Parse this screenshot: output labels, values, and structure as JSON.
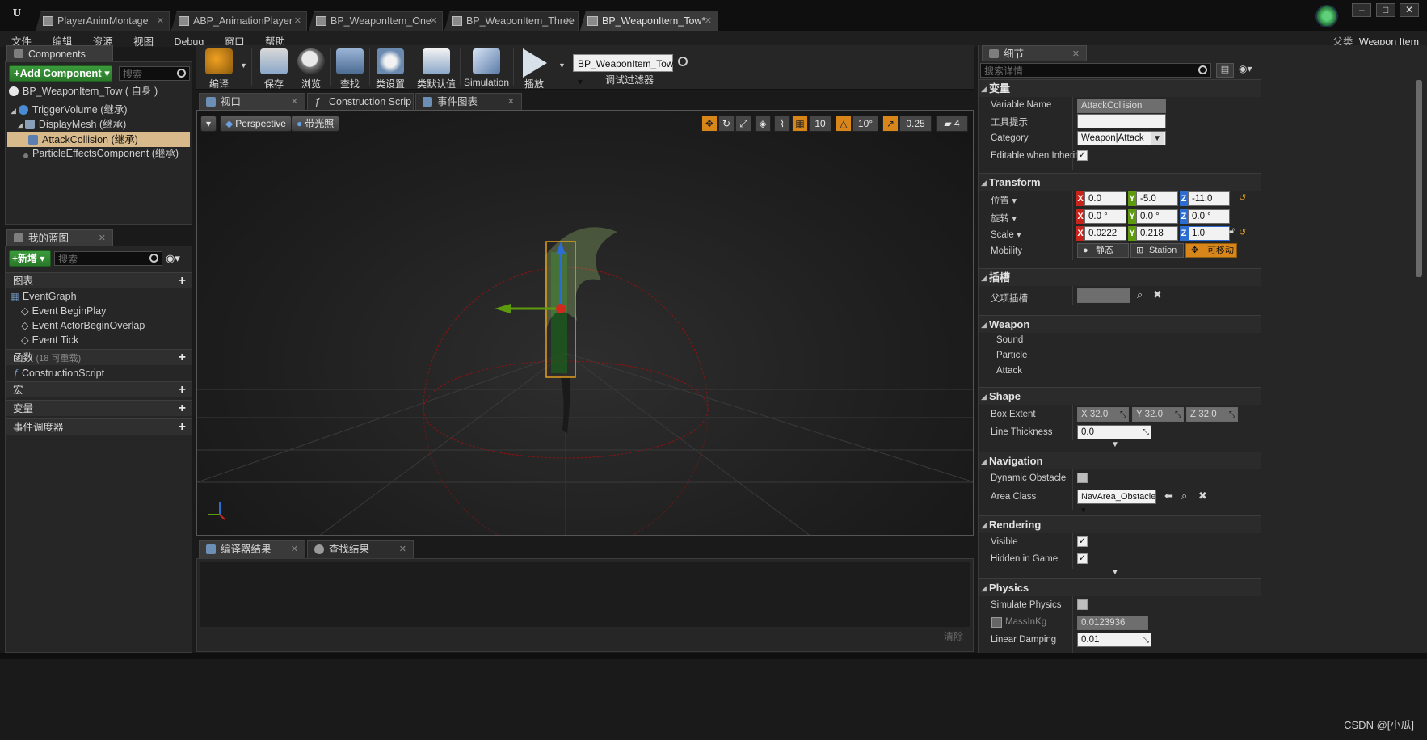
{
  "tabs": [
    {
      "label": "PlayerAnimMontage"
    },
    {
      "label": "ABP_AnimationPlayer"
    },
    {
      "label": "BP_WeaponItem_One"
    },
    {
      "label": "BP_WeaponItem_Three"
    },
    {
      "label": "BP_WeaponItem_Tow*"
    }
  ],
  "window_buttons": {
    "minimize": "–",
    "maximize": "□",
    "close": "✕"
  },
  "menu": [
    "文件",
    "编辑",
    "资源",
    "视图",
    "Debug",
    "窗口",
    "帮助"
  ],
  "parent_class": {
    "label": "父类",
    "value": "Weapon Item"
  },
  "components": {
    "tab_label": "Components",
    "add_button": "+Add Component ▾",
    "search_placeholder": "搜索",
    "self_label": "BP_WeaponItem_Tow ( 自身 )",
    "tree": [
      {
        "label": "TriggerVolume (继承)",
        "color": "#4a8bd6"
      },
      {
        "label": "DisplayMesh (继承)",
        "color": "#8aa0b8"
      },
      {
        "label": "AttackCollision (继承)",
        "color": "#5a7fb0",
        "selected": true
      },
      {
        "label": "ParticleEffectsComponent (继承)",
        "color": "#7a7a7a"
      }
    ]
  },
  "my_blueprint": {
    "tab_label": "我的蓝图",
    "new_button": "+新增 ▾",
    "search_placeholder": "搜索",
    "graphs_header": "图表",
    "event_graph": "EventGraph",
    "events": [
      "Event BeginPlay",
      "Event ActorBeginOverlap",
      "Event Tick"
    ],
    "functions_header": "函数",
    "functions_note": "(18 可重载)",
    "construction_script": "ConstructionScript",
    "macros_header": "宏",
    "variables_header": "变量",
    "dispatchers_header": "事件调度器"
  },
  "toolbar": {
    "compile": "编译",
    "save": "保存",
    "browse": "浏览",
    "find": "查找",
    "class_settings": "类设置",
    "class_defaults": "类默认值",
    "simulation": "Simulation",
    "play": "播放",
    "debug_object": "BP_WeaponItem_Tow ▾",
    "debug_filter": "调试过滤器"
  },
  "editor_tabs": [
    {
      "label": "视口"
    },
    {
      "label": "Construction Scrip"
    },
    {
      "label": "事件图表"
    }
  ],
  "viewport": {
    "view_mode": "Perspective",
    "lighting": "带光照",
    "grid_snap": "10",
    "rotation_snap": "10°",
    "scale_snap": "0.25",
    "camera_speed": "4"
  },
  "output_tabs": [
    {
      "label": "编译器结果"
    },
    {
      "label": "查找结果"
    }
  ],
  "output_clear": "清除",
  "details": {
    "tab_label": "细节",
    "search_placeholder": "搜索详情",
    "variable": {
      "header": "变量",
      "name_label": "Variable Name",
      "name_value": "AttackCollision",
      "tooltip_label": "工具提示",
      "tooltip_value": "",
      "category_label": "Category",
      "category_value": "Weapon|Attack",
      "editable_label": "Editable when Inherited",
      "editable_checked": "✓"
    },
    "transform": {
      "header": "Transform",
      "location_label": "位置 ▾",
      "location": [
        "0.0",
        "-5.0",
        "-11.0"
      ],
      "rotation_label": "旋转 ▾",
      "rotation": [
        "0.0 °",
        "0.0 °",
        "0.0 °"
      ],
      "scale_label": "Scale ▾",
      "scale": [
        "0.0222",
        "0.218",
        "1.0"
      ],
      "mobility_label": "Mobility",
      "mobility_options": [
        "静态",
        "Station",
        "可移动"
      ]
    },
    "socket": {
      "header": "插槽",
      "parent_label": "父项插槽"
    },
    "weapon": {
      "header": "Weapon",
      "items": [
        "Sound",
        "Particle",
        "Attack"
      ]
    },
    "shape": {
      "header": "Shape",
      "box_extent_label": "Box Extent",
      "box_extent": [
        "X 32.0",
        "Y 32.0",
        "Z 32.0"
      ],
      "line_thickness_label": "Line Thickness",
      "line_thickness": "0.0"
    },
    "navigation": {
      "header": "Navigation",
      "dynamic_obstacle_label": "Dynamic Obstacle",
      "area_class_label": "Area Class",
      "area_class_value": "NavArea_Obstacle ▾"
    },
    "rendering": {
      "header": "Rendering",
      "visible_label": "Visible",
      "hidden_label": "Hidden in Game",
      "checked": "✓"
    },
    "physics": {
      "header": "Physics",
      "simulate_label": "Simulate Physics",
      "mass_label": "MassInKg",
      "mass_value": "0.0123936",
      "damping_label": "Linear Damping",
      "damping_value": "0.01"
    }
  },
  "axis_labels": {
    "x": "X",
    "y": "Y",
    "z": "Z"
  },
  "watermark": "CSDN @[小瓜]",
  "colors": {
    "accent_orange": "#d8851a",
    "green_button": "#3b9a3b",
    "selected_row": "#d8b98b"
  }
}
